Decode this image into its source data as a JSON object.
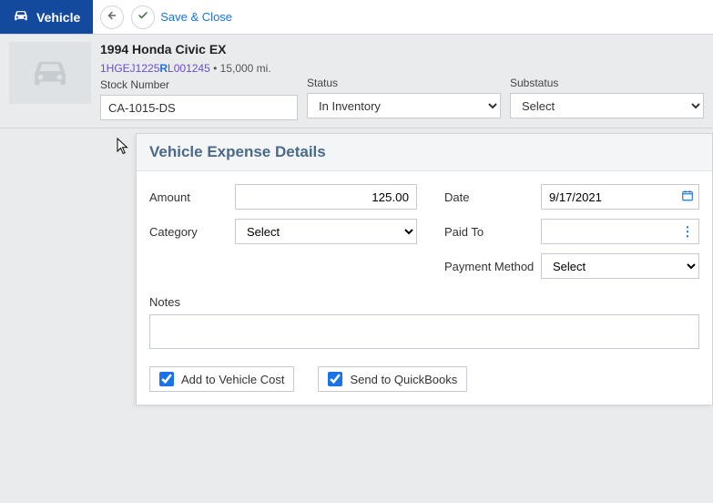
{
  "topbar": {
    "title": "Vehicle",
    "save_close": "Save & Close"
  },
  "vehicle": {
    "title": "1994 Honda Civic EX",
    "vin_part1": "1HGEJ1225",
    "vin_r": "R",
    "vin_part2": "L001245",
    "miles_sep": " • ",
    "miles": "15,000 mi.",
    "stock_label": "Stock Number",
    "stock_value": "CA-1015-DS",
    "status_label": "Status",
    "status_value": "In Inventory",
    "substatus_label": "Substatus",
    "substatus_value": "Select"
  },
  "card": {
    "title": "Vehicle Expense Details",
    "amount_label": "Amount",
    "amount_value": "125.00",
    "category_label": "Category",
    "category_value": "Select",
    "date_label": "Date",
    "date_value": "9/17/2021",
    "paidto_label": "Paid To",
    "paidto_value": "",
    "payment_method_label": "Payment Method",
    "payment_method_value": "Select",
    "notes_label": "Notes",
    "notes_value": "",
    "check1_label": "Add to Vehicle Cost",
    "check2_label": "Send to QuickBooks"
  }
}
